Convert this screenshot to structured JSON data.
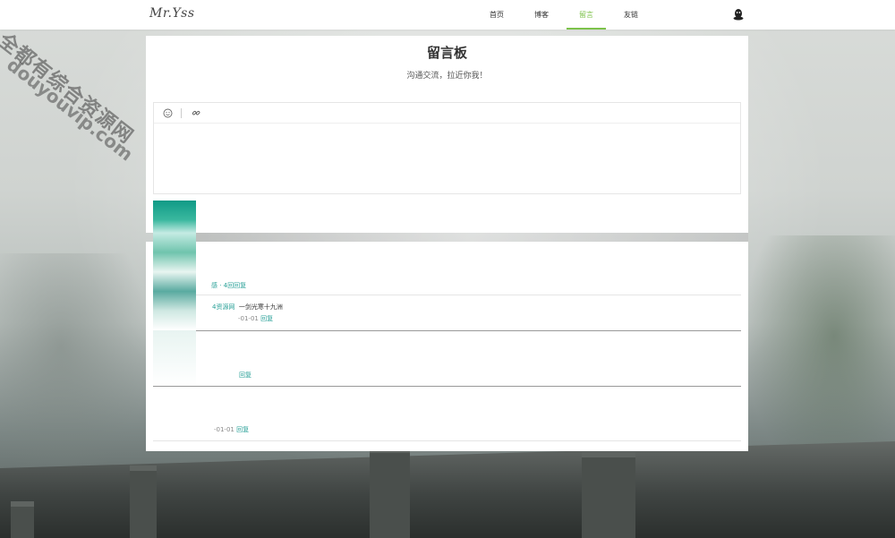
{
  "header": {
    "logo": "Mr.Yss",
    "nav": [
      {
        "label": "首页"
      },
      {
        "label": "博客"
      },
      {
        "label": "留言"
      },
      {
        "label": "友链"
      }
    ],
    "active_nav": "留言",
    "accent_color": "#7cc24a"
  },
  "board": {
    "title": "留言板",
    "subtitle": "沟通交流，拉近你我！",
    "toolbar": {
      "emoji_icon": "smiley-icon",
      "link_icon": "link-icon"
    },
    "textarea_value": ""
  },
  "comments": [
    {
      "meta": "感",
      "name": "· 4回",
      "reply": "回复",
      "text": ""
    },
    {
      "meta": "",
      "name": "4资源网",
      "text": "一剑光寒十九洲",
      "date": "-01-01",
      "reply": "回复"
    },
    {
      "meta": "",
      "name": "",
      "text": "",
      "date": "",
      "reply": "回复"
    },
    {
      "meta": "",
      "name": "",
      "text": "",
      "date": "-01-01",
      "reply": "回复"
    }
  ],
  "watermark": {
    "line1": "全都有综合资源网",
    "line2": "douyouvip.com"
  }
}
